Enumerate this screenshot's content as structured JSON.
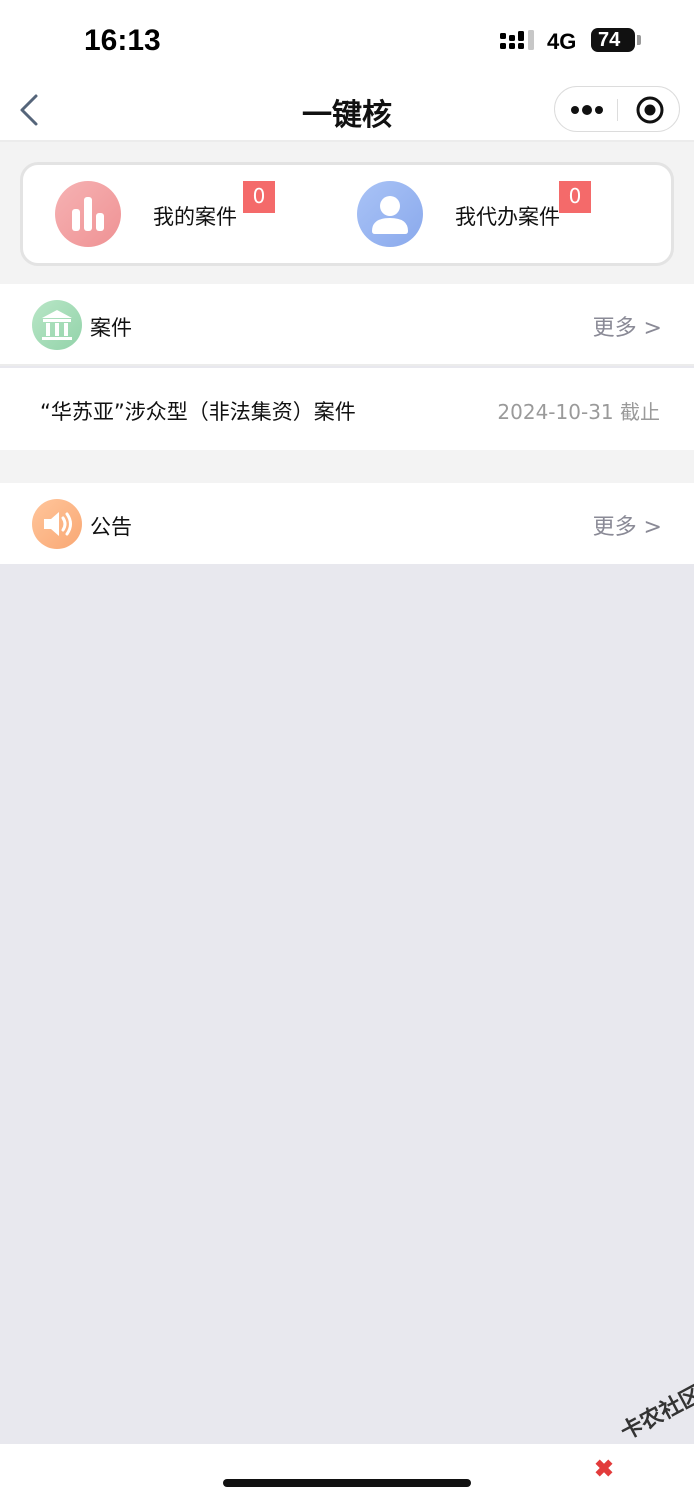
{
  "status_bar": {
    "time": "16:13",
    "network": "4G",
    "battery": "74"
  },
  "nav": {
    "title": "一键核"
  },
  "quick_links": {
    "my_cases": {
      "label": "我的案件",
      "badge": "0"
    },
    "proxy_cases": {
      "label": "我代办案件",
      "badge": "0"
    }
  },
  "cases": {
    "title": "案件",
    "more": "更多 >",
    "items": [
      {
        "title": "“华苏亚”涉众型（非法集资）案件",
        "deadline": "2024-10-31 截止"
      }
    ]
  },
  "notices": {
    "title": "公告",
    "more": "更多 >"
  },
  "watermark": {
    "text": "卡农社区"
  },
  "colors": {
    "badge": "#f46a6a",
    "page_background": "#e8e8ee",
    "muted_text": "#9a9a9a"
  }
}
